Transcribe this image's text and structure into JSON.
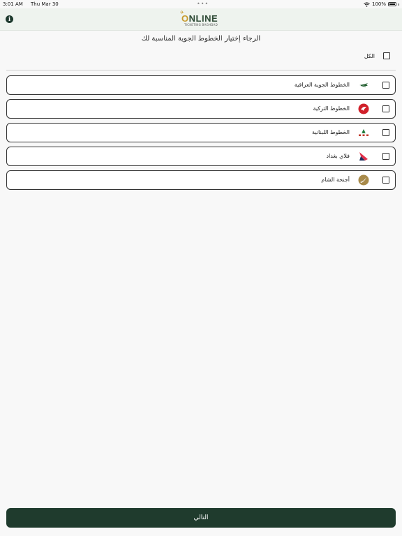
{
  "status_bar": {
    "time": "3:01 AM",
    "date": "Thu Mar 30",
    "dots": "•••",
    "battery": "100%"
  },
  "header": {
    "logo_main_prefix": "O",
    "logo_main_rest": "NLINE",
    "logo_sub": "TICKETING BAGHDAD"
  },
  "title": "الرجاء إختيار الخطوط الجوية المناسبة لك",
  "select_all": {
    "label": "الكل"
  },
  "airlines": [
    {
      "name": "الخطوط الجوية العراقية",
      "icon": "iraqi-airways-logo"
    },
    {
      "name": "الخطوط التركية",
      "icon": "turkish-airlines-logo"
    },
    {
      "name": "الخطوط اللبنانية",
      "icon": "mea-logo"
    },
    {
      "name": "فلاي بغداد",
      "icon": "fly-baghdad-logo"
    },
    {
      "name": "أجنحة الشام",
      "icon": "cham-wings-logo"
    }
  ],
  "next_button": {
    "label": "التالي"
  },
  "colors": {
    "primary": "#1f3b2d",
    "accent": "#c79a2c",
    "header_bg": "#eef3ee"
  }
}
